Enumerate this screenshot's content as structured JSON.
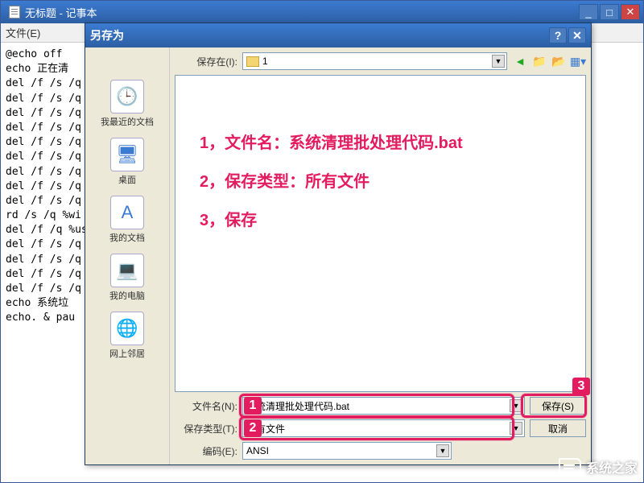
{
  "notepad": {
    "title": "无标题 - 记事本",
    "menu_file": "文件(E)",
    "content_lines": [
      "@echo off",
      "echo 正在清",
      "del /f /s /q %",
      "del /f /s /q %",
      "del /f /s /q %",
      "del /f /s /q %",
      "del /f /s /q %",
      "del /f /s /q %",
      "del /f /s /q %",
      "del /f /s /q %",
      "del /f /s /q %",
      "rd /s /q %wi",
      "del /f /q %us",
      "del /f /s /q \"%",
      "del /f /s /q \"%",
      "del /f /s /q \"%",
      "del /f /s /q \"%",
      "echo 系统垃",
      "echo. & pau"
    ]
  },
  "dialog": {
    "title": "另存为",
    "location_label": "保存在(I):",
    "location_value": "1",
    "sidebar": [
      {
        "label": "我最近的文档",
        "icon": "🕒"
      },
      {
        "label": "桌面",
        "icon": "🖥"
      },
      {
        "label": "我的文档",
        "icon": "A"
      },
      {
        "label": "我的电脑",
        "icon": "💻"
      },
      {
        "label": "网上邻居",
        "icon": "🌐"
      }
    ],
    "filename_label": "文件名(N):",
    "filename_value": "系统清理批处理代码.bat",
    "filetype_label": "保存类型(T):",
    "filetype_value": "所有文件",
    "encoding_label": "编码(E):",
    "encoding_value": "ANSI",
    "save_btn": "保存(S)",
    "cancel_btn": "取消"
  },
  "annotations": {
    "line1": "1，文件名：系统清理批处理代码.bat",
    "line2": "2，保存类型：所有文件",
    "line3": "3，保存",
    "badge1": "1",
    "badge2": "2",
    "badge3": "3"
  },
  "watermark": "系统之家"
}
